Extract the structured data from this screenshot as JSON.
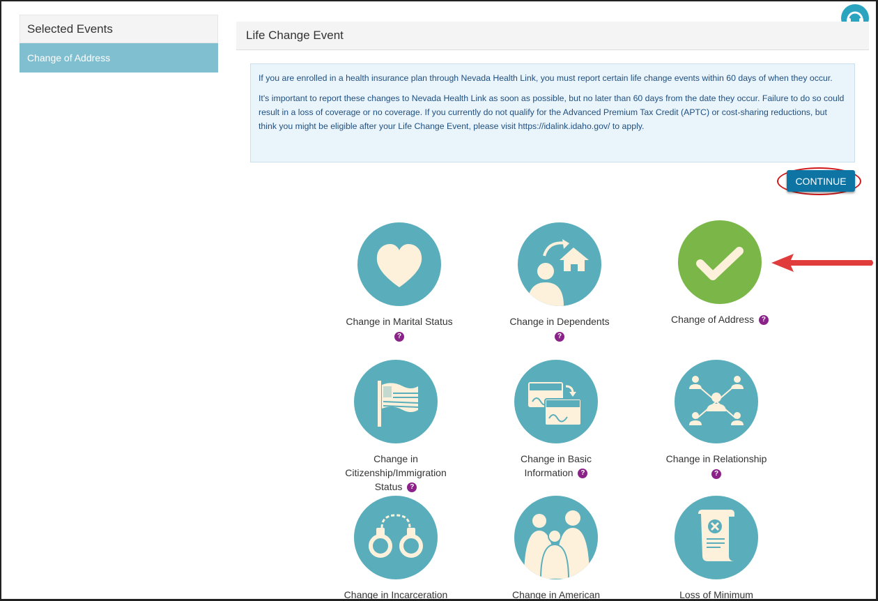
{
  "sidebar": {
    "header": "Selected Events",
    "items": [
      {
        "label": "Change of Address"
      }
    ]
  },
  "panel": {
    "title": "Life Change Event"
  },
  "notice": {
    "p1": "If you are enrolled in a health insurance plan through Nevada Health Link, you must report certain life change events within 60 days of when they occur.",
    "p2": "It's important to report these changes to Nevada Health Link as soon as possible, but no later than 60 days from the date they occur. Failure to do so could result in a loss of coverage or no coverage. If you currently do not qualify for the Advanced Premium Tax Credit (APTC) or cost-sharing reductions, but think you might be eligible after your Life Change Event, please visit https://idalink.idaho.gov/ to apply."
  },
  "actions": {
    "continue_label": "CONTINUE"
  },
  "help_glyph": "?",
  "colors": {
    "tile_default": "#5aaebb",
    "tile_selected": "#7ab648",
    "icon_fill": "#fdf1dc",
    "primary_button": "#0d74a4",
    "help_badge": "#8b2289",
    "highlight": "#d01818"
  },
  "events": [
    {
      "id": "marital",
      "line1": "Change in Marital Status",
      "line2": "",
      "line3": "",
      "icon": "heart-icon",
      "selected": false
    },
    {
      "id": "dependents",
      "line1": "Change in Dependents",
      "line2": "",
      "line3": "",
      "icon": "person-house-icon",
      "selected": false
    },
    {
      "id": "address",
      "line1": "Change of Address",
      "line2": "",
      "line3": "",
      "icon": "checkmark-icon",
      "selected": true
    },
    {
      "id": "citizenship",
      "line1": "Change in",
      "line2": "Citizenship/Immigration",
      "line3": "Status",
      "icon": "flag-icon",
      "selected": false
    },
    {
      "id": "basic",
      "line1": "Change in Basic",
      "line2": "Information",
      "line3": "",
      "icon": "name-tag-icon",
      "selected": false
    },
    {
      "id": "relationship",
      "line1": "Change in Relationship",
      "line2": "",
      "line3": "",
      "icon": "network-icon",
      "selected": false
    },
    {
      "id": "incarceration",
      "line1": "Change in Incarceration",
      "line2": "",
      "line3": "",
      "icon": "handcuffs-icon",
      "selected": false
    },
    {
      "id": "american",
      "line1": "Change in American",
      "line2": "",
      "line3": "",
      "icon": "family-icon",
      "selected": false
    },
    {
      "id": "loss",
      "line1": "Loss of Minimum",
      "line2": "",
      "line3": "",
      "icon": "document-x-icon",
      "selected": false
    }
  ]
}
